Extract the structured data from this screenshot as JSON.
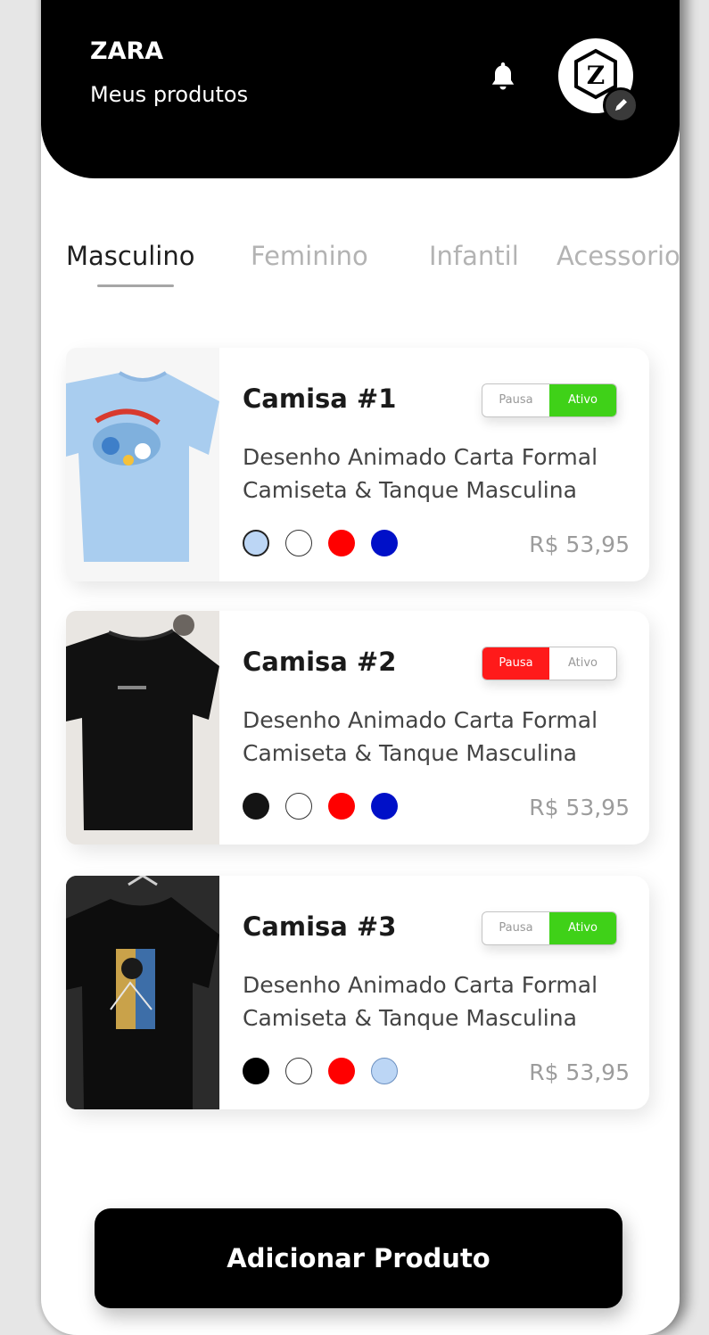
{
  "header": {
    "brand": "ZARA",
    "subtitle": "Meus produtos",
    "icons": [
      "bell-icon",
      "zara-logo-avatar",
      "pencil-icon"
    ],
    "avatar_letter": "Z"
  },
  "tabs": [
    {
      "label": "Masculino",
      "active": true
    },
    {
      "label": "Feminino",
      "active": false
    },
    {
      "label": "Infantil",
      "active": false
    },
    {
      "label": "Acessorio",
      "active": false
    }
  ],
  "products": [
    {
      "title": "Camisa #1",
      "desc_line1": "Desenho  Animado Carta Formal",
      "desc_line2": "Camiseta & Tanque Masculina",
      "price": "R$ 53,95",
      "toggle": {
        "pause": "Pausa",
        "active": "Ativo",
        "state": "active"
      },
      "colors": [
        "#bcd6f5",
        "#ffffff",
        "#ff0000",
        "#0010c8"
      ],
      "image": "light-blue-tshirt"
    },
    {
      "title": "Camisa #2",
      "desc_line1": "Desenho  Animado Carta Formal",
      "desc_line2": "Camiseta & Tanque Masculina",
      "price": "R$ 53,95",
      "toggle": {
        "pause": "Pausa",
        "active": "Ativo",
        "state": "paused"
      },
      "colors": [
        "#141414",
        "#ffffff",
        "#ff0000",
        "#0010c8"
      ],
      "image": "black-tshirt"
    },
    {
      "title": "Camisa #3",
      "desc_line1": "Desenho  Animado Carta Formal",
      "desc_line2": "Camiseta & Tanque Masculina",
      "price": "R$ 53,95",
      "toggle": {
        "pause": "Pausa",
        "active": "Ativo",
        "state": "active"
      },
      "colors": [
        "#000000",
        "#ffffff",
        "#ff0000",
        "#bcd6f5"
      ],
      "image": "black-printed-tshirt"
    }
  ],
  "add_button": "Adicionar Produto",
  "colors": {
    "accent_green": "#3fd118",
    "accent_red": "#ff1a1a",
    "header_bg": "#000000"
  }
}
